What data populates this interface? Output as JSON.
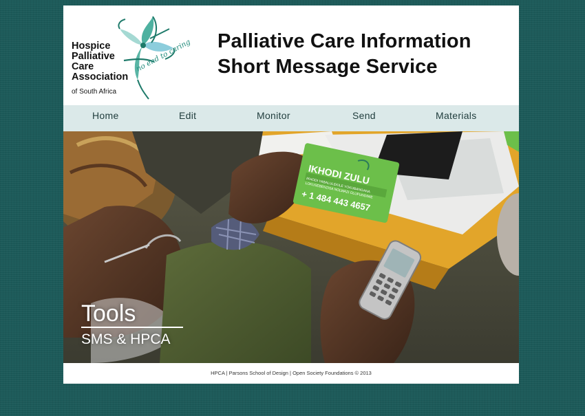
{
  "header": {
    "logo": {
      "name_lines": [
        "Hospice",
        "Palliative",
        "Care",
        "Association"
      ],
      "sub": "of South Africa",
      "tagline": "no end to caring"
    },
    "title_line1": "Palliative Care Information",
    "title_line2": "Short Message Service"
  },
  "nav": {
    "items": [
      "Home",
      "Edit",
      "Monitor",
      "Send",
      "Materials"
    ]
  },
  "hero": {
    "title": "Tools",
    "subtitle": "SMS & HPCA",
    "card": {
      "name": "IKHODI ZULU",
      "line1": "IKHODI YABALULEKILE YOKUBANGANA",
      "line2": "LOKUSEBENZISA NOLWAZI OLUFUNDIWE",
      "phone": "+ 1 484 443 4657"
    }
  },
  "footer": {
    "text": "HPCA | Parsons School of Design | Open Society Foundations © 2013"
  },
  "colors": {
    "background": "#1c5a59",
    "nav_bg": "#dbe9e9",
    "logo_teal": "#1e8a7a",
    "card_green": "#6cbf4a"
  }
}
